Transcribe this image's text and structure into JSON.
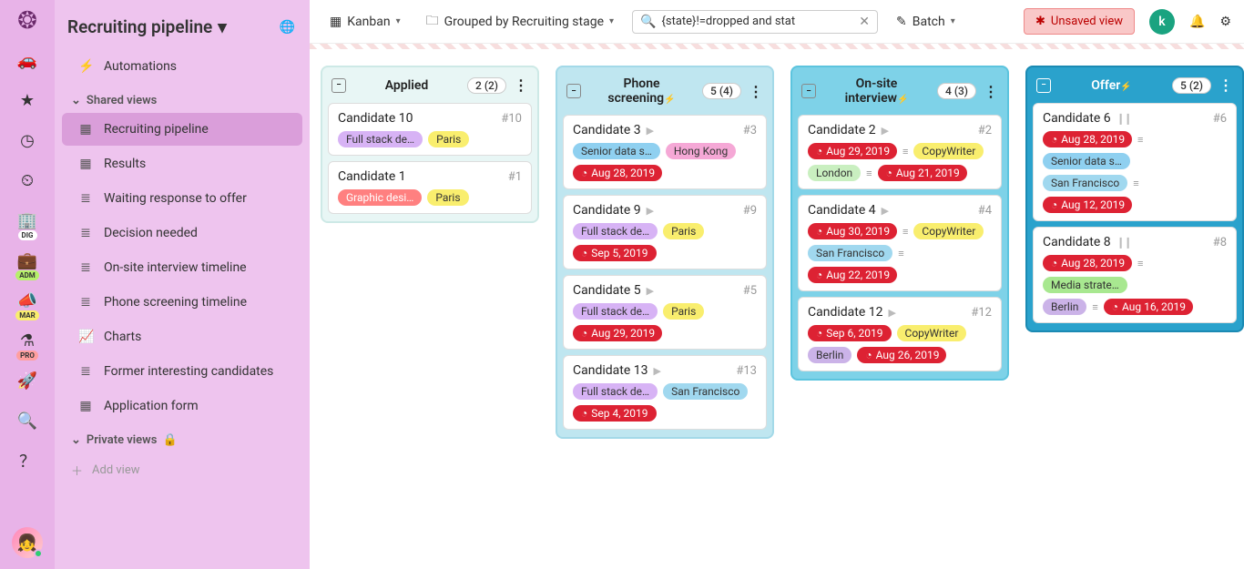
{
  "rail": {
    "badges": {
      "dig": "DIG",
      "adm": "ADM",
      "mar": "MAR",
      "pro": "PRO"
    }
  },
  "sidebar": {
    "title": "Recruiting pipeline",
    "automations": "Automations",
    "shared_label": "Shared views",
    "private_label": "Private views",
    "addview": "Add view",
    "items": [
      {
        "label": "Recruiting pipeline",
        "icon": "▦",
        "active": true
      },
      {
        "label": "Results",
        "icon": "▦"
      },
      {
        "label": "Waiting response to offer",
        "icon": "≣"
      },
      {
        "label": "Decision needed",
        "icon": "≣"
      },
      {
        "label": "On-site interview timeline",
        "icon": "≣"
      },
      {
        "label": "Phone screening timeline",
        "icon": "≣"
      },
      {
        "label": "Charts",
        "icon": "📈"
      },
      {
        "label": "Former interesting candidates",
        "icon": "≣"
      },
      {
        "label": "Application form",
        "icon": "▦"
      }
    ]
  },
  "topbar": {
    "view": "Kanban",
    "group": "Grouped by Recruiting stage",
    "search": "{state}!=dropped and stat",
    "batch": "Batch",
    "unsaved": "Unsaved view",
    "userletter": "k"
  },
  "cols": [
    {
      "cls": "applied",
      "title": "Applied",
      "count": "2 (2)",
      "bolt": false
    },
    {
      "cls": "phone",
      "title": "Phone screening",
      "count": "5 (4)",
      "bolt": true
    },
    {
      "cls": "onsite",
      "title": "On-site interview",
      "count": "4 (3)",
      "bolt": true
    },
    {
      "cls": "offer",
      "title": "Offer",
      "count": "5 (2)",
      "bolt": true
    }
  ],
  "cards": {
    "c10": {
      "name": "Candidate 10",
      "num": "#10",
      "role": "Full stack de…",
      "rolecls": "role-fsd",
      "city": "Paris",
      "citycls": "city-paris"
    },
    "c1": {
      "name": "Candidate 1",
      "num": "#1",
      "role": "Graphic desi…",
      "rolecls": "role-gd",
      "city": "Paris",
      "citycls": "city-paris"
    },
    "c3": {
      "name": "Candidate 3",
      "num": "#3",
      "role": "Senior data s…",
      "rolecls": "role-sds",
      "city": "Hong Kong",
      "citycls": "city-hk",
      "date": "Aug 28, 2019"
    },
    "c9": {
      "name": "Candidate 9",
      "num": "#9",
      "role": "Full stack de…",
      "rolecls": "role-fsd",
      "city": "Paris",
      "citycls": "city-paris",
      "date": "Sep 5, 2019"
    },
    "c5": {
      "name": "Candidate 5",
      "num": "#5",
      "role": "Full stack de…",
      "rolecls": "role-fsd",
      "city": "Paris",
      "citycls": "city-paris",
      "date": "Aug 29, 2019"
    },
    "c13": {
      "name": "Candidate 13",
      "num": "#13",
      "role": "Full stack de…",
      "rolecls": "role-fsd",
      "city": "San Francisco",
      "citycls": "city-sf",
      "date": "Sep 4, 2019"
    },
    "c2": {
      "name": "Candidate 2",
      "num": "#2",
      "date1": "Aug 29, 2019",
      "role": "CopyWriter",
      "rolecls": "role-cw",
      "city": "London",
      "citycls": "city-london",
      "date2": "Aug 21, 2019"
    },
    "c4": {
      "name": "Candidate 4",
      "num": "#4",
      "date1": "Aug 30, 2019",
      "role": "CopyWriter",
      "rolecls": "role-cw",
      "city": "San Francisco",
      "citycls": "city-sf",
      "date2": "Aug 22, 2019"
    },
    "c12": {
      "name": "Candidate 12",
      "num": "#12",
      "date1": "Sep 6, 2019",
      "role": "CopyWriter",
      "rolecls": "role-cw",
      "city": "Berlin",
      "citycls": "city-berlin",
      "date2": "Aug 26, 2019"
    },
    "c6": {
      "name": "Candidate 6",
      "num": "#6",
      "date1": "Aug 28, 2019",
      "role": "Senior data s…",
      "rolecls": "role-sds",
      "city": "San Francisco",
      "citycls": "city-sf",
      "date2": "Aug 12, 2019"
    },
    "c8": {
      "name": "Candidate 8",
      "num": "#8",
      "date1": "Aug 28, 2019",
      "role": "Media strate…",
      "rolecls": "role-ms",
      "city": "Berlin",
      "citycls": "city-berlin",
      "date2": "Aug 16, 2019"
    }
  }
}
